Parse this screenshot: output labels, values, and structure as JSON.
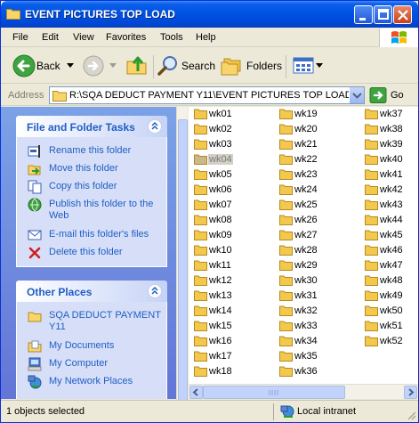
{
  "window": {
    "title": "EVENT PICTURES TOP LOAD"
  },
  "menu": {
    "items": [
      "File",
      "Edit",
      "View",
      "Favorites",
      "Tools",
      "Help"
    ]
  },
  "toolbar": {
    "back_label": "Back",
    "search_label": "Search",
    "folders_label": "Folders"
  },
  "address": {
    "label": "Address",
    "value": "R:\\SQA DEDUCT PAYMENT Y11\\EVENT PICTURES TOP LOAD",
    "go_label": "Go"
  },
  "tasks_panel": {
    "title": "File and Folder Tasks",
    "items": [
      {
        "label": "Rename this folder",
        "icon": "rename-icon"
      },
      {
        "label": "Move this folder",
        "icon": "move-icon"
      },
      {
        "label": "Copy this folder",
        "icon": "copy-icon"
      },
      {
        "label": "Publish this folder to the Web",
        "icon": "publish-web-icon"
      },
      {
        "label": "E-mail this folder's files",
        "icon": "email-icon"
      },
      {
        "label": "Delete this folder",
        "icon": "delete-icon"
      }
    ]
  },
  "places_panel": {
    "title": "Other Places",
    "items": [
      {
        "label": "SQA DEDUCT PAYMENT Y11",
        "icon": "folder-icon"
      },
      {
        "label": "My Documents",
        "icon": "my-documents-icon"
      },
      {
        "label": "My Computer",
        "icon": "my-computer-icon"
      },
      {
        "label": "My Network Places",
        "icon": "network-places-icon"
      }
    ]
  },
  "files": {
    "selected": "wk04",
    "columns": [
      [
        "wk01",
        "wk02",
        "wk03",
        "wk04",
        "wk05",
        "wk06",
        "wk07",
        "wk08",
        "wk09",
        "wk10",
        "wk11",
        "wk12",
        "wk13",
        "wk14",
        "wk15",
        "wk16",
        "wk17",
        "wk18"
      ],
      [
        "wk19",
        "wk20",
        "wk21",
        "wk22",
        "wk23",
        "wk24",
        "wk25",
        "wk26",
        "wk27",
        "wk28",
        "wk29",
        "wk30",
        "wk31",
        "wk32",
        "wk33",
        "wk34",
        "wk35",
        "wk36"
      ],
      [
        "wk37",
        "wk38",
        "wk39",
        "wk40",
        "wk41",
        "wk42",
        "wk43",
        "wk44",
        "wk45",
        "wk46",
        "wk47",
        "wk48",
        "wk49",
        "wk50",
        "wk51",
        "wk52"
      ]
    ]
  },
  "status": {
    "selection": "1 objects selected",
    "zone": "Local intranet"
  },
  "colors": {
    "title_bar": "#0053e4",
    "task_link": "#215dc6",
    "pane_bg": "#6375d6",
    "folder": "#f2c94c"
  }
}
